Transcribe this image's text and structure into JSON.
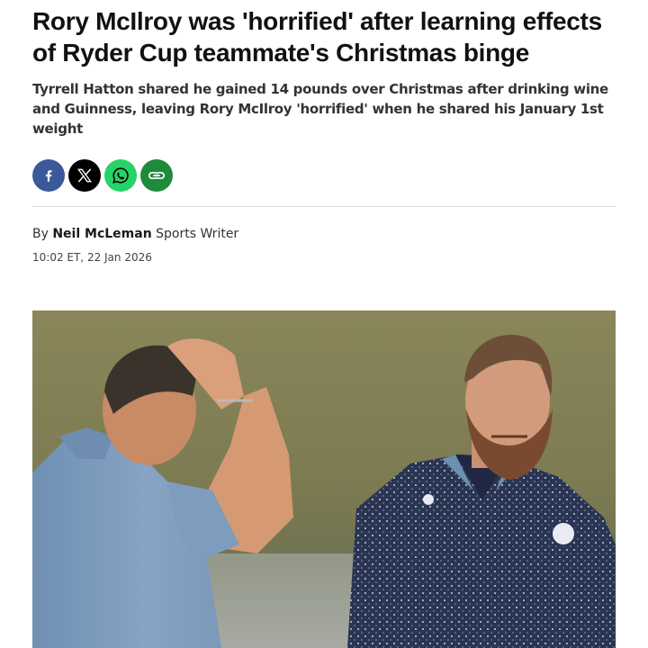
{
  "article": {
    "headline": "Rory McIlroy was 'horrified' after learning effects of Ryder Cup teammate's Christmas binge",
    "standfirst": "Tyrrell Hatton shared he gained 14 pounds over Christmas after drinking wine and Guinness, leaving Rory McIlroy 'horrified' when he shared his January 1st weight",
    "byline_prefix": "By",
    "author": "Neil McLeman",
    "author_role": "Sports Writer",
    "timestamp": "10:02 ET, 22 Jan 2026"
  },
  "share": [
    {
      "icon": "facebook-icon",
      "color": "#3b5998"
    },
    {
      "icon": "x-icon",
      "color": "#000000"
    },
    {
      "icon": "whatsapp-icon",
      "color": "#25d366"
    },
    {
      "icon": "link-icon",
      "color": "#1e8a3c"
    }
  ]
}
